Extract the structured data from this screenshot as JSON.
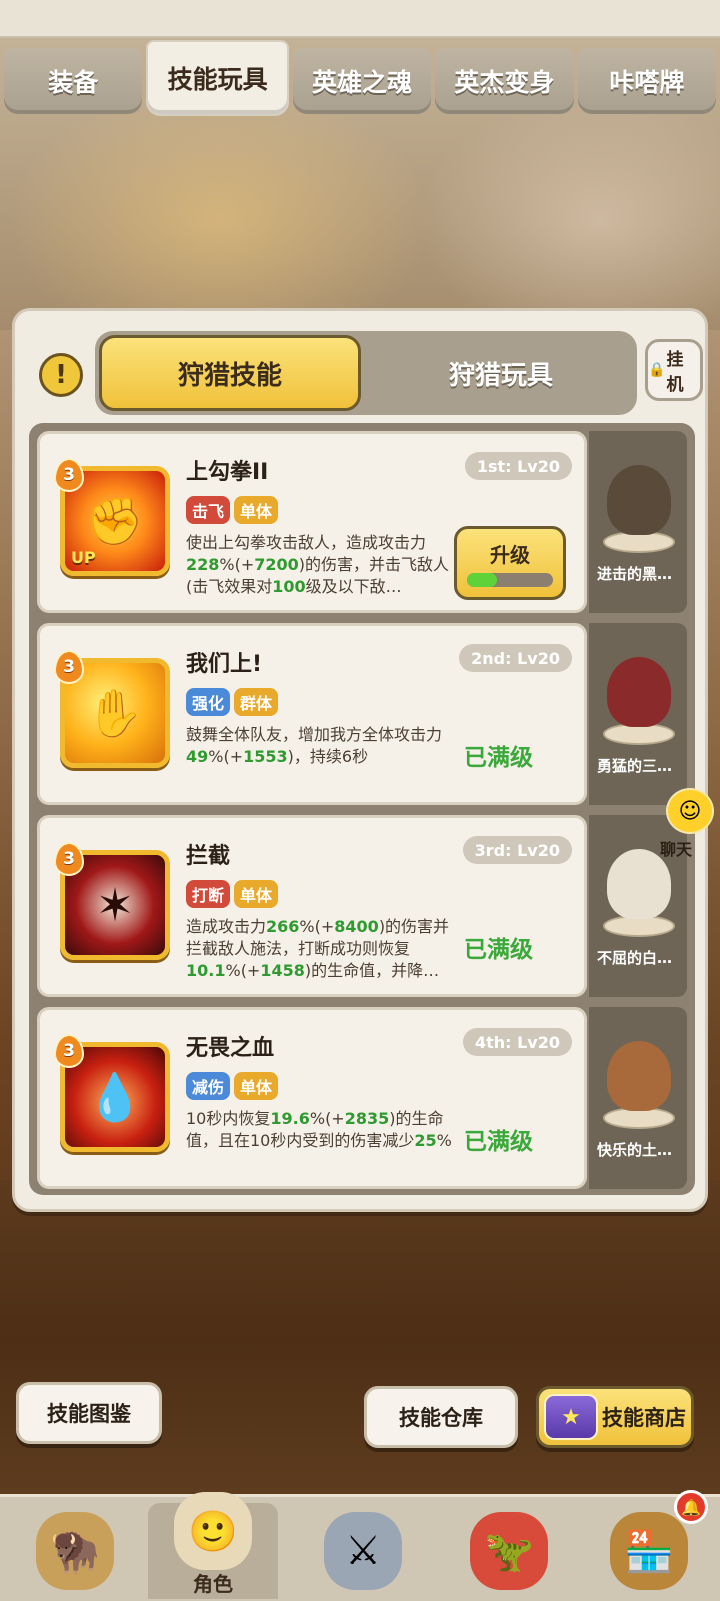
{
  "tabs": [
    "装备",
    "技能玩具",
    "英雄之魂",
    "英杰变身",
    "咔嗒牌"
  ],
  "active_tab": "技能玩具",
  "subtabs": {
    "active": "狩猎技能",
    "inactive": "狩猎玩具"
  },
  "idle_button": "挂机",
  "skills": [
    {
      "name": "上勾拳II",
      "rank": "1st: Lv20",
      "level": "3",
      "icon_badge": "UP",
      "tags": [
        {
          "label": "击飞",
          "color": "#d24a3a"
        },
        {
          "label": "单体",
          "color": "#e9a92a"
        }
      ],
      "desc": [
        {
          "t": "使出上勾拳攻击敌人，造成攻击力"
        },
        {
          "t": "228",
          "n": true
        },
        {
          "t": "%(+"
        },
        {
          "t": "7200",
          "n": true
        },
        {
          "t": ")的伤害，并击飞敌人(击飞效果对"
        },
        {
          "t": "100",
          "n": true
        },
        {
          "t": "级及以下敌…"
        }
      ],
      "action": "升级",
      "action_progress": 0.35,
      "pet_name": "进击的黑…",
      "pet_color": "#5a4a3a"
    },
    {
      "name": "我们上!",
      "rank": "2nd: Lv20",
      "level": "3",
      "tags": [
        {
          "label": "强化",
          "color": "#4a8ad8"
        },
        {
          "label": "群体",
          "color": "#e9a92a"
        }
      ],
      "desc": [
        {
          "t": "鼓舞全体队友，增加我方全体攻击力"
        },
        {
          "t": "49",
          "n": true
        },
        {
          "t": "%(+"
        },
        {
          "t": "1553",
          "n": true
        },
        {
          "t": ")，持续6秒"
        }
      ],
      "action": "已满级",
      "pet_name": "勇猛的三…",
      "pet_color": "#8a2a2a"
    },
    {
      "name": "拦截",
      "rank": "3rd: Lv20",
      "level": "3",
      "tags": [
        {
          "label": "打断",
          "color": "#d24a3a"
        },
        {
          "label": "单体",
          "color": "#e9a92a"
        }
      ],
      "desc": [
        {
          "t": "造成攻击力"
        },
        {
          "t": "266",
          "n": true
        },
        {
          "t": "%(+"
        },
        {
          "t": "8400",
          "n": true
        },
        {
          "t": ")的伤害并拦截敌人施法，打断成功则恢复"
        },
        {
          "t": "10.1",
          "n": true
        },
        {
          "t": "%(+"
        },
        {
          "t": "1458",
          "n": true
        },
        {
          "t": ")的生命值，并降…"
        }
      ],
      "action": "已满级",
      "pet_name": "不屈的白…",
      "pet_color": "#e8e0d0"
    },
    {
      "name": "无畏之血",
      "rank": "4th: Lv20",
      "level": "3",
      "tags": [
        {
          "label": "减伤",
          "color": "#4a8ad8"
        },
        {
          "label": "单体",
          "color": "#e9a92a"
        }
      ],
      "desc": [
        {
          "t": "10秒内恢复"
        },
        {
          "t": "19.6",
          "n": true
        },
        {
          "t": "%(+"
        },
        {
          "t": "2835",
          "n": true
        },
        {
          "t": ")的生命值，且在10秒内受到的伤害减少"
        },
        {
          "t": "25",
          "n": true
        },
        {
          "t": "%"
        }
      ],
      "action": "已满级",
      "pet_name": "快乐的土…",
      "pet_color": "#a86a3a"
    }
  ],
  "chat_label": "聊天",
  "bottom_buttons": {
    "codex": "技能图鉴",
    "storage": "技能仓库",
    "shop": "技能商店"
  },
  "nav": {
    "active_label": "角色"
  },
  "colors": {
    "accent_yellow": "#f0c13a",
    "maxed_green": "#3aa83a",
    "number_green": "#2f9a30"
  }
}
